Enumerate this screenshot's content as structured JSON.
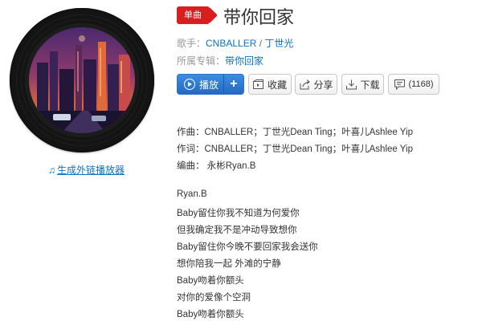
{
  "song": {
    "badge": "单曲",
    "title": "带你回家",
    "singer_label": "歌手：",
    "singers": [
      "CNBALLER",
      "丁世光"
    ],
    "singer_sep": " / ",
    "album_label": "所属专辑：",
    "album": "带你回家"
  },
  "player": {
    "generate_link": "生成外链播放器"
  },
  "actions": {
    "play": "播放",
    "add": "+",
    "collect": "收藏",
    "share": "分享",
    "download": "下载",
    "comment_count": "(1168)"
  },
  "lyrics": [
    "作曲：CNBALLER；丁世光Dean Ting；叶喜儿Ashlee Yip",
    "作词：CNBALLER；丁世光Dean Ting；叶喜儿Ashlee Yip",
    "编曲： 永彬Ryan.B",
    "",
    "Ryan.B",
    "Baby留住你我不知道为何爱你",
    "但我确定我不是冲动导致想你",
    "Baby留住你今晚不要回家我会送你",
    "想你陪我一起 外滩的宁静",
    "Baby吻着你额头",
    "对你的爱像个空洞",
    "Baby吻着你额头"
  ],
  "colors": {
    "badge": "#d81e1e",
    "link": "#0c73c2",
    "play_button": "#2a74c9"
  }
}
